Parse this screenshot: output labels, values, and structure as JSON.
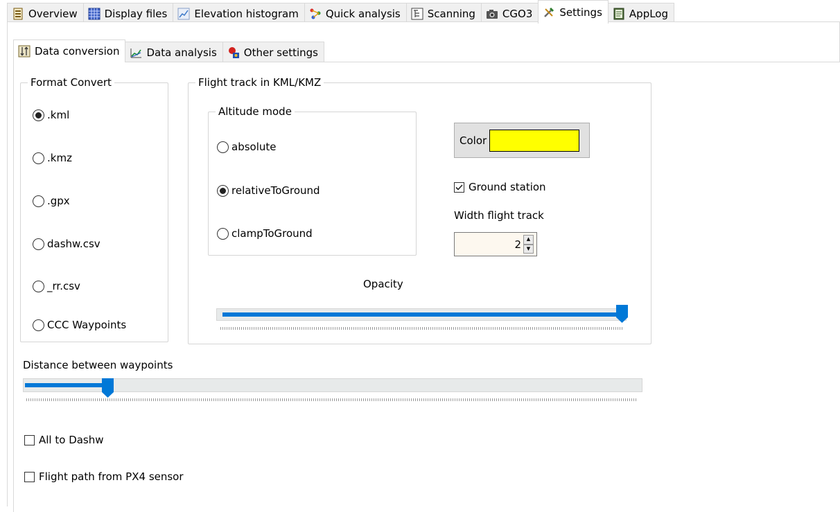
{
  "top_tabs": [
    {
      "label": "Overview"
    },
    {
      "label": "Display files"
    },
    {
      "label": "Elevation histogram"
    },
    {
      "label": "Quick analysis"
    },
    {
      "label": "Scanning"
    },
    {
      "label": "CGO3"
    },
    {
      "label": "Settings",
      "active": true
    },
    {
      "label": "AppLog"
    }
  ],
  "sub_tabs": [
    {
      "label": "Data conversion",
      "active": true
    },
    {
      "label": "Data analysis"
    },
    {
      "label": "Other settings"
    }
  ],
  "format_convert": {
    "title": "Format Convert",
    "options": [
      ".kml",
      ".kmz",
      ".gpx",
      "dashw.csv",
      "_rr.csv",
      "CCC Waypoints"
    ],
    "selected": ".kml"
  },
  "flight_track": {
    "title": "Flight track in KML/KMZ",
    "altitude_mode": {
      "title": "Altitude mode",
      "options": [
        "absolute",
        "relativeToGround",
        "clampToGround"
      ],
      "selected": "relativeToGround"
    },
    "color_label": "Color",
    "color_value": "#ffff00",
    "ground_station_label": "Ground station",
    "ground_station_checked": true,
    "width_label": "Width flight track",
    "width_value": "2",
    "opacity_label": "Opacity",
    "opacity_level": 1.0
  },
  "distance_label": "Distance between waypoints",
  "distance_level": 0.14,
  "all_to_dashw_label": "All to Dashw",
  "all_to_dashw_checked": false,
  "px4_label": "Flight path from PX4 sensor",
  "px4_checked": false,
  "colors": {
    "accent": "#0078d7",
    "selected_swatch": "#ffff00"
  }
}
